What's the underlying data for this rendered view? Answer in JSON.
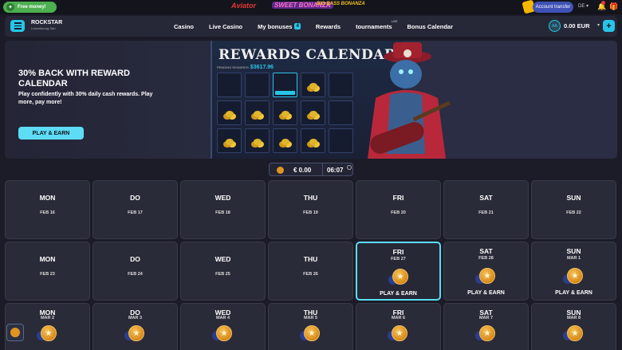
{
  "topbar": {
    "free_money": "Free money!",
    "brand_aviator": "Aviator",
    "brand_sweet": "SWEET BONANZA",
    "brand_bigbass": "BIG BASS BONANZA",
    "account_transfer": "Account transfer",
    "language": "DE"
  },
  "header": {
    "logo": "ROCKSTAR",
    "logo_sub": "Luxembourg Sàrl",
    "nav": [
      {
        "label": "Casino"
      },
      {
        "label": "Live Casino"
      },
      {
        "label": "My bonuses",
        "badge": "4"
      },
      {
        "label": "Rewards"
      },
      {
        "label": "tournaments",
        "sup": "LIVE"
      },
      {
        "label": "Bonus Calendar"
      }
    ],
    "avatar": "AA",
    "balance": "0.00 EUR"
  },
  "banner": {
    "title": "30% BACK WITH REWARD CALENDAR",
    "subtitle": "Play confidently with 30% daily cash rewards. Play more, pay more!",
    "cta": "PLAY & EARN",
    "image_title": "REWARDS CALENDAR",
    "pending_label": "PENDING REWARDS:",
    "pending_value": "$3617.96"
  },
  "timer": {
    "amount": "€ 0.00",
    "time": "06:07"
  },
  "days": {
    "row1": [
      {
        "name": "MON",
        "date": "FEB 16"
      },
      {
        "name": "DO",
        "date": "FEB 17"
      },
      {
        "name": "WED",
        "date": "FEB 18"
      },
      {
        "name": "THU",
        "date": "FEB 19"
      },
      {
        "name": "FRI",
        "date": "FEB 20"
      },
      {
        "name": "SAT",
        "date": "FEB 21"
      },
      {
        "name": "SUN",
        "date": "FEB 22"
      }
    ],
    "row2": [
      {
        "name": "MON",
        "date": "FEB 23"
      },
      {
        "name": "DO",
        "date": "FEB 24"
      },
      {
        "name": "WED",
        "date": "FEB 25"
      },
      {
        "name": "THU",
        "date": "FEB 26"
      },
      {
        "name": "FRI",
        "date": "FEB 27",
        "earn": "PLAY & EARN"
      },
      {
        "name": "SAT",
        "date": "FEB 28",
        "earn": "PLAY & EARN"
      },
      {
        "name": "SUN",
        "date": "MAR 1",
        "earn": "PLAY & EARN"
      }
    ],
    "row3": [
      {
        "name": "MON",
        "date": "MAR 2"
      },
      {
        "name": "DO",
        "date": "MAR 3"
      },
      {
        "name": "WED",
        "date": "MAR 4"
      },
      {
        "name": "THU",
        "date": "MAR 5"
      },
      {
        "name": "FRI",
        "date": "MAR 6"
      },
      {
        "name": "SAT",
        "date": "MAR 7"
      },
      {
        "name": "SUN",
        "date": "MAR 8"
      }
    ]
  },
  "colors": {
    "accent": "#5ddcf5",
    "background": "#1b1c27",
    "card": "#2a2b38",
    "coin": "#e09422"
  }
}
